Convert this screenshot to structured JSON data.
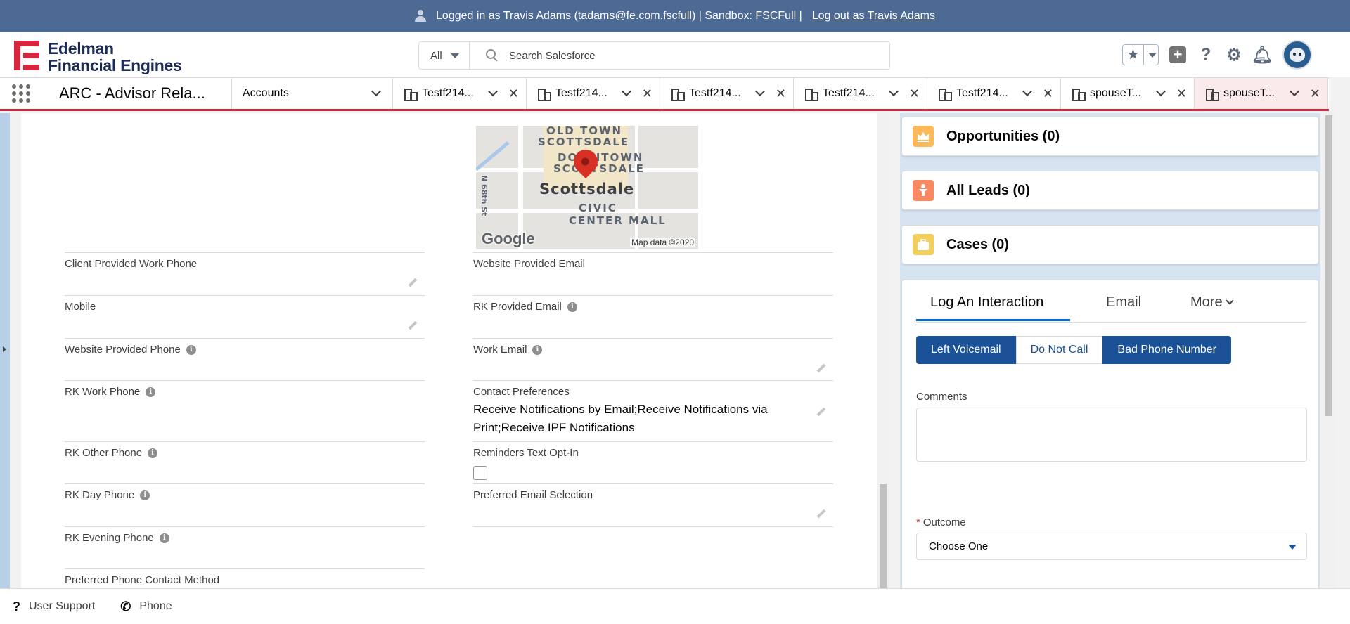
{
  "banner": {
    "text": "Logged in as Travis Adams (tadams@fe.com.fscfull) | Sandbox: FSCFull |",
    "logout": "Log out as Travis Adams"
  },
  "header": {
    "logo_line1": "Edelman",
    "logo_line2": "Financial Engines",
    "search_scope": "All",
    "search_placeholder": "Search Salesforce"
  },
  "nav": {
    "app_name": "ARC - Advisor Rela...",
    "accounts": "Accounts",
    "tabs": [
      {
        "label": "Testf214..."
      },
      {
        "label": "Testf214..."
      },
      {
        "label": "Testf214..."
      },
      {
        "label": "Testf214..."
      },
      {
        "label": "Testf214..."
      },
      {
        "label": "spouseT..."
      },
      {
        "label": "spouseT..."
      }
    ]
  },
  "map": {
    "old_town_1": "OLD TOWN",
    "old_town_2": "SCOTTSDALE",
    "downtown_1": "DOWNTOWN",
    "downtown_2": "SCOTTSDALE",
    "city": "Scottsdale",
    "street": "N 68th St",
    "civic_1": "CIVIC",
    "civic_2": "CENTER MALL",
    "brand": "Google",
    "attribution": "Map data ©2020"
  },
  "fields_left": [
    {
      "label": "Client Provided Work Phone",
      "value": ""
    },
    {
      "label": "Mobile",
      "value": ""
    },
    {
      "label": "Website Provided Phone",
      "value": ""
    },
    {
      "label": "RK Work Phone",
      "value": ""
    },
    {
      "label": "RK Other Phone",
      "value": ""
    },
    {
      "label": "RK Day Phone",
      "value": ""
    },
    {
      "label": "RK Evening Phone",
      "value": ""
    },
    {
      "label": "Preferred Phone Contact Method",
      "value": ""
    }
  ],
  "fields_right": [
    {
      "label": "Website Provided Email",
      "value": ""
    },
    {
      "label": "RK Provided Email",
      "value": ""
    },
    {
      "label": "Work Email",
      "value": ""
    },
    {
      "label": "Contact Preferences",
      "value": "Receive Notifications by Email;Receive Notifications via Print;Receive IPF Notifications"
    },
    {
      "label": "Reminders Text Opt-In",
      "value": "",
      "checked": false
    },
    {
      "label": "Preferred Email Selection",
      "value": ""
    }
  ],
  "related": [
    {
      "title": "Opportunities (0)",
      "color": "#fcb95b"
    },
    {
      "title": "All Leads (0)",
      "color": "#f88962"
    },
    {
      "title": "Cases (0)",
      "color": "#f2cf5b"
    }
  ],
  "interaction": {
    "tabs": [
      "Log An Interaction",
      "Email",
      "More"
    ],
    "buttons": [
      "Left Voicemail",
      "Do Not Call",
      "Bad Phone Number"
    ],
    "comments_label": "Comments",
    "outcome_label": "Outcome",
    "outcome_required": "*",
    "outcome_value": "Choose One"
  },
  "utility": {
    "support": "User Support",
    "phone": "Phone"
  },
  "colors": {
    "banner": "#4d6a94",
    "brand_red": "#d8263e",
    "brand_blue": "#1b5297"
  }
}
